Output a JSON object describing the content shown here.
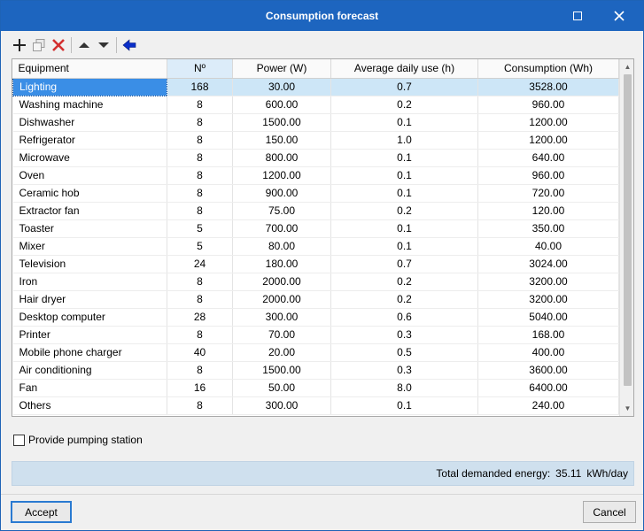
{
  "window": {
    "title": "Consumption forecast"
  },
  "colors": {
    "titlebar": "#1d65bf",
    "selection": "#3a8ee6",
    "row_highlight": "#cde6f7",
    "delete_icon": "#d32f2f",
    "back_arrow": "#0a2fc9"
  },
  "toolbar": {
    "icons": [
      "add-icon",
      "copy-icon",
      "delete-icon",
      "move-up-icon",
      "move-down-icon",
      "back-arrow-icon"
    ]
  },
  "table": {
    "columns": [
      "Equipment",
      "Nº",
      "Power (W)",
      "Average daily use (h)",
      "Consumption (Wh)"
    ],
    "rows": [
      [
        "Lighting",
        "168",
        "30.00",
        "0.7",
        "3528.00"
      ],
      [
        "Washing machine",
        "8",
        "600.00",
        "0.2",
        "960.00"
      ],
      [
        "Dishwasher",
        "8",
        "1500.00",
        "0.1",
        "1200.00"
      ],
      [
        "Refrigerator",
        "8",
        "150.00",
        "1.0",
        "1200.00"
      ],
      [
        "Microwave",
        "8",
        "800.00",
        "0.1",
        "640.00"
      ],
      [
        "Oven",
        "8",
        "1200.00",
        "0.1",
        "960.00"
      ],
      [
        "Ceramic hob",
        "8",
        "900.00",
        "0.1",
        "720.00"
      ],
      [
        "Extractor fan",
        "8",
        "75.00",
        "0.2",
        "120.00"
      ],
      [
        "Toaster",
        "5",
        "700.00",
        "0.1",
        "350.00"
      ],
      [
        "Mixer",
        "5",
        "80.00",
        "0.1",
        "40.00"
      ],
      [
        "Television",
        "24",
        "180.00",
        "0.7",
        "3024.00"
      ],
      [
        "Iron",
        "8",
        "2000.00",
        "0.2",
        "3200.00"
      ],
      [
        "Hair dryer",
        "8",
        "2000.00",
        "0.2",
        "3200.00"
      ],
      [
        "Desktop computer",
        "28",
        "300.00",
        "0.6",
        "5040.00"
      ],
      [
        "Printer",
        "8",
        "70.00",
        "0.3",
        "168.00"
      ],
      [
        "Mobile phone charger",
        "40",
        "20.00",
        "0.5",
        "400.00"
      ],
      [
        "Air conditioning",
        "8",
        "1500.00",
        "0.3",
        "3600.00"
      ],
      [
        "Fan",
        "16",
        "50.00",
        "8.0",
        "6400.00"
      ],
      [
        "Others",
        "8",
        "300.00",
        "0.1",
        "240.00"
      ]
    ],
    "selected_row": 0
  },
  "options": {
    "pumping_label": "Provide pumping station",
    "pumping_checked": false
  },
  "totals": {
    "label": "Total demanded energy:",
    "value": "35.11",
    "unit": "kWh/day"
  },
  "buttons": {
    "accept": "Accept",
    "cancel": "Cancel"
  }
}
